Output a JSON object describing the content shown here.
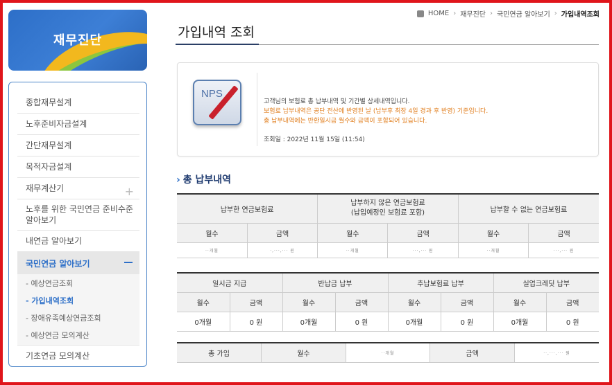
{
  "brand": {
    "title": "재무진단"
  },
  "sidebar": {
    "items": [
      {
        "label": "종합재무설계"
      },
      {
        "label": "노후준비자금설계"
      },
      {
        "label": "간단재무설계"
      },
      {
        "label": "목적자금설계"
      },
      {
        "label": "재무계산기"
      },
      {
        "label": "노후를 위한 국민연금 준비수준 알아보기"
      },
      {
        "label": "내연금 알아보기"
      },
      {
        "label": "국민연금 알아보기"
      },
      {
        "label": "기초연금 모의계산"
      }
    ],
    "subitems": [
      {
        "label": "- 예상연금조회"
      },
      {
        "label": "- 가입내역조회"
      },
      {
        "label": "- 장애유족예상연금조회"
      },
      {
        "label": "- 예상연금 모의계산"
      }
    ]
  },
  "breadcrumb": {
    "home": "HOME",
    "level1": "재무진단",
    "level2": "국민연금 알아보기",
    "current": "가입내역조회"
  },
  "page": {
    "title": "가입내역 조회"
  },
  "info": {
    "logo_text": "NPS",
    "line1": "고객님의 보험료 총 납부내역 및 기간별 상세내역입니다.",
    "line2": "보험료 납부내역은 공단 전산에 반영된 날 (납부후 최장 4일 경과 후 반영) 기준입니다.",
    "line3": "총 납부내역에는 반환일시금 월수와 금액이 포함되어 있습니다.",
    "line4": "조회일 : 2022년 11월 15일 (11:54)"
  },
  "section": {
    "title": "총 납부내역"
  },
  "table1": {
    "headers": [
      "납부한 연금보험료",
      "납부하지 않은 연금보험료\n(납입예정인 보험료 포함)",
      "납부할 수 없는 연금보험료"
    ],
    "sub": [
      "월수",
      "금액",
      "월수",
      "금액",
      "월수",
      "금액"
    ],
    "row": [
      "··개월",
      "·,···,··· 원",
      "··개월",
      "···,··· 원",
      "··개월",
      "···,··· 원"
    ]
  },
  "table2": {
    "headers": [
      "일시금 지급",
      "반납금 납부",
      "추납보험료 납부",
      "실업크레딧 납부"
    ],
    "sub": [
      "월수",
      "금액",
      "월수",
      "금액",
      "월수",
      "금액",
      "월수",
      "금액"
    ],
    "row": [
      "0개월",
      "0 원",
      "0개월",
      "0 원",
      "0개월",
      "0 원",
      "0개월",
      "0 원"
    ]
  },
  "table3": {
    "cells": [
      "총 가입",
      "월수",
      "··개월",
      "금액",
      "··,···,··· 원"
    ]
  }
}
